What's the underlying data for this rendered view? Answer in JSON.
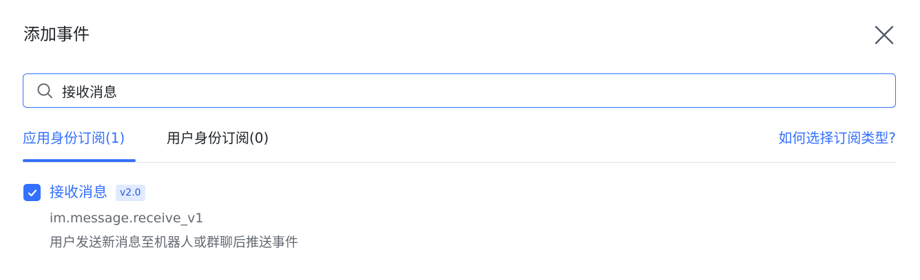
{
  "dialog": {
    "title": "添加事件",
    "close_icon": "close-icon"
  },
  "search": {
    "value": "接收消息",
    "icon": "search-icon"
  },
  "tabs": [
    {
      "label": "应用身份订阅(1)",
      "active": true
    },
    {
      "label": "用户身份订阅(0)",
      "active": false
    }
  ],
  "help_link": "如何选择订阅类型?",
  "events": [
    {
      "name": "接收消息",
      "version": "v2.0",
      "key": "im.message.receive_v1",
      "description": "用户发送新消息至机器人或群聊后推送事件",
      "checked": true
    }
  ],
  "colors": {
    "accent": "#3370ff",
    "text": "#1f2329",
    "secondary_text": "#646a73",
    "badge_bg": "#e1eaff",
    "divider": "#dee0e3"
  }
}
